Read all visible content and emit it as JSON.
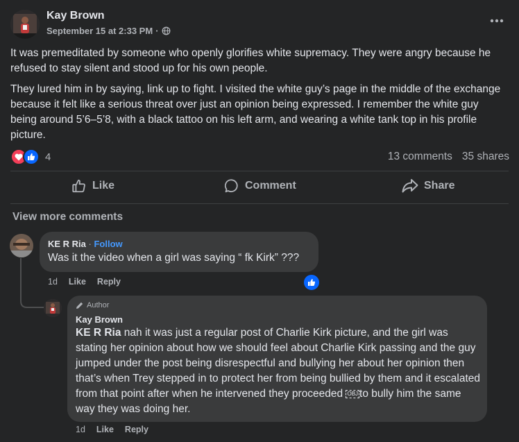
{
  "post": {
    "author": "Kay Brown",
    "date": "September 15 at 2:33 PM",
    "dot": "·",
    "paragraph1": "It was premeditated by someone who openly glorifies white supremacy. They were angry because he refused to stay silent and stood up for his own people.",
    "paragraph2": "They lured him in by saying, link up to fight. I visited the white guy’s page in the middle of the exchange because it felt like a serious threat over just an opinion being expressed. I remember the white guy being around 5’6–5’8, with a black tattoo on his left arm, and wearing a white tank top in his profile picture.",
    "reaction_count": "4",
    "comments_count": "13 comments",
    "shares_count": "35 shares",
    "more_icon": "more-horizontal-icon",
    "privacy_icon": "globe-icon",
    "reaction_icons": [
      "love-icon",
      "like-icon"
    ]
  },
  "actions": {
    "like": "Like",
    "comment": "Comment",
    "share": "Share"
  },
  "view_more": "View more comments",
  "comment1": {
    "name": "KE R Ria",
    "sep": " · ",
    "follow": "Follow",
    "text": "Was it the video when a girl was saying “ fk Kirk” ???",
    "time": "1d",
    "like": "Like",
    "reply": "Reply"
  },
  "reply1": {
    "badge": "Author",
    "name": "Kay Brown",
    "mention": "KE R Ria",
    "text": " nah it was just a regular post of Charlie Kirk picture, and the girl was stating her opinion about how we should feel about Charlie Kirk passing and the guy jumped under the post being disrespectful and bullying her about her opinion then that’s when Trey stepped in to protect her from being bullied by them and it escalated from that point after when he intervened they proceeded ",
    "glyph": "OBJ",
    "text_end": "to bully him the same way they was doing her.",
    "time": "1d",
    "like": "Like",
    "reply": "Reply"
  },
  "colors": {
    "background": "#242526",
    "bubble": "#3a3b3c",
    "text": "#e4e6eb",
    "secondary": "#b0b3b8",
    "link": "#4599ff",
    "like_blue": "#0866ff",
    "love_red": "#f33e58"
  }
}
